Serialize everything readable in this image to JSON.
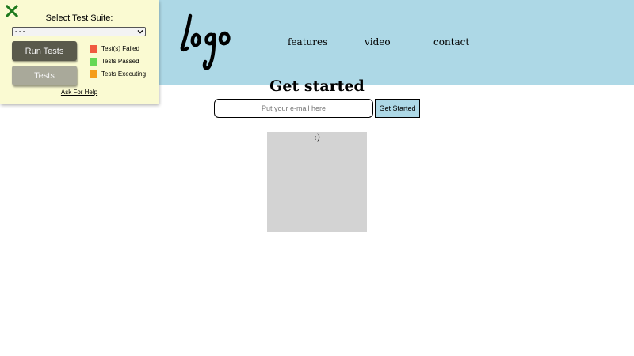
{
  "header": {
    "logo_text": "Logo",
    "nav": [
      {
        "label": "features"
      },
      {
        "label": "video"
      },
      {
        "label": "contact"
      }
    ]
  },
  "main": {
    "title": "Get started",
    "email_placeholder": "Put your e-mail here",
    "cta_label": "Get Started",
    "box_text": ":)"
  },
  "test_panel": {
    "title": "Select Test Suite:",
    "select_value": "- - -",
    "run_button": "Run Tests",
    "tests_button": "Tests",
    "legend": [
      {
        "label": "Test(s) Failed",
        "color": "#f05a40"
      },
      {
        "label": "Tests Passed",
        "color": "#66d855"
      },
      {
        "label": "Tests Executing",
        "color": "#f59d18"
      }
    ],
    "help_link": "Ask For Help"
  },
  "colors": {
    "header_bg": "#add8e6",
    "panel_bg": "#fafad2",
    "close_icon": "#1e7a1e",
    "box_bg": "#d3d3d3"
  }
}
